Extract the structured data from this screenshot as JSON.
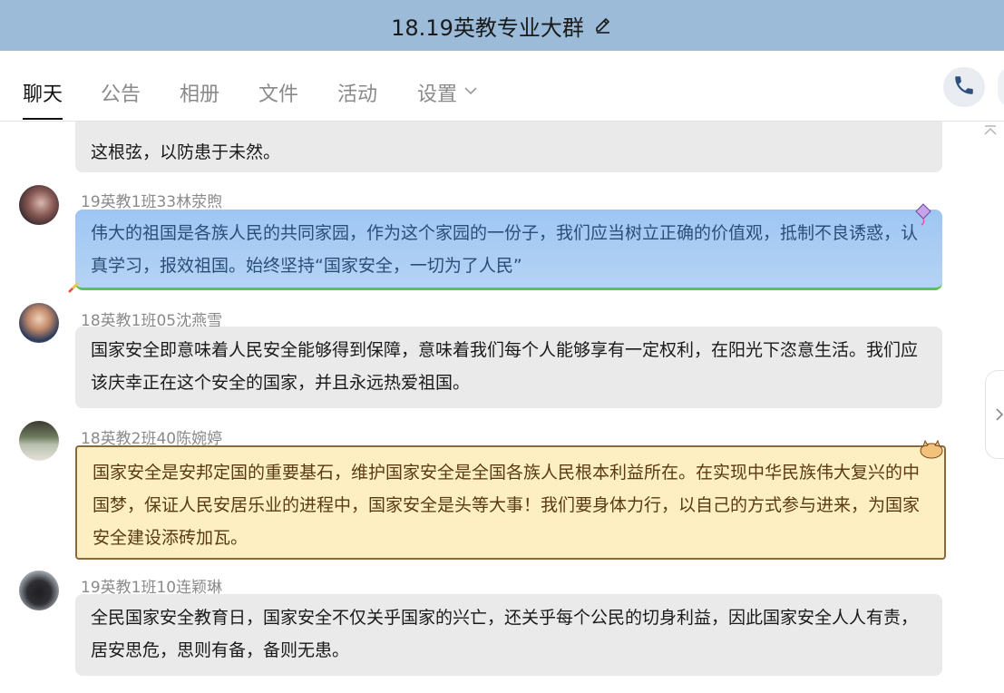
{
  "window": {
    "title": "18.19英教专业大群",
    "icon": "pencil-edit-icon"
  },
  "tabs": [
    {
      "label": "聊天",
      "active": true
    },
    {
      "label": "公告"
    },
    {
      "label": "相册"
    },
    {
      "label": "文件"
    },
    {
      "label": "活动"
    },
    {
      "label": "设置"
    }
  ],
  "actions": {
    "call_icon": "phone-icon"
  },
  "messages": [
    {
      "sender": "",
      "text": "这根弦，以防患于未然。",
      "style": "gray"
    },
    {
      "sender": "19英教1班33林荥煦",
      "text": "伟大的祖国是各族人民的共同家园，作为这个家园的一份子，我们应当树立正确的价值观，抵制不良诱惑，认真学习，报效祖国。始终坚持“国家安全，一切为了人民”",
      "style": "blue"
    },
    {
      "sender": "18英教1班05沈燕雪",
      "text": "国家安全即意味着人民安全能够得到保障，意味着我们每个人能够享有一定权利，在阳光下恣意生活。我们应该庆幸正在这个安全的国家，并且永远热爱祖国。",
      "style": "gray"
    },
    {
      "sender": "18英教2班40陈婉婷",
      "text": "国家安全是安邦定国的重要基石，维护国家安全是全国各族人民根本利益所在。在实现中华民族伟大复兴的中国梦，保证人民安居乐业的进程中，国家安全是头等大事！我们要身体力行，以自己的方式参与进来，为国家安全建设添砖加瓦。",
      "style": "scroll"
    },
    {
      "sender": "19英教1班10连颖琳",
      "text": "全民国家安全教育日，国家安全不仅关乎国家的兴亡，还关乎每个公民的切身利益，因此国家安全人人有责，居安思危，思则有备，备则无患。",
      "style": "gray"
    }
  ]
}
